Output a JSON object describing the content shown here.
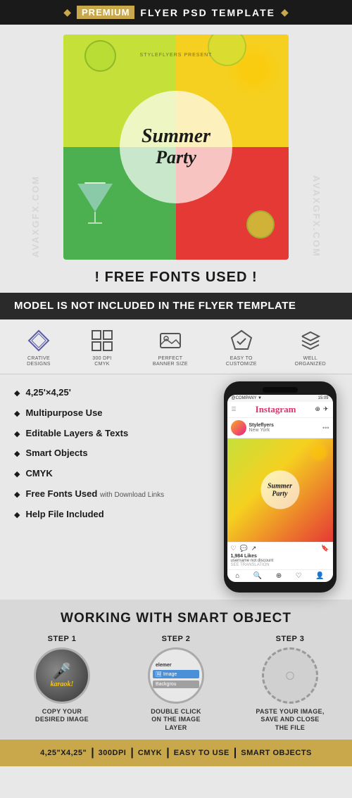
{
  "header": {
    "diamond_left": "◆",
    "diamond_right": "◆",
    "premium_label": "PREMIUM",
    "title": "FLYER PSD TEMPLATE"
  },
  "flyer": {
    "small_text": "STYLEFLYERS PRESENT",
    "title_line1": "Summer",
    "title_line2": "Party"
  },
  "free_fonts": {
    "label": "! FREE FONTS USED !"
  },
  "model_banner": {
    "text": "MODEL IS NOT INCLUDED IN THE FLYER TEMPLATE"
  },
  "icons": [
    {
      "label": "CRATIVE\nDESIGNS",
      "shape": "diamond"
    },
    {
      "label": "300 DPI\nCMYK",
      "shape": "grid"
    },
    {
      "label": "PERFECT\nBANNER SIZE",
      "shape": "image"
    },
    {
      "label": "EASY TO\nCUSTOMIZE",
      "shape": "diamond-check"
    },
    {
      "label": "WELL\nORGANIZED",
      "shape": "layers"
    }
  ],
  "features": [
    {
      "text": "4,25'×4,25'"
    },
    {
      "text": "Multipurpose Use"
    },
    {
      "text": "Editable Layers & Texts"
    },
    {
      "text": "Smart Objects"
    },
    {
      "text": "CMYK"
    },
    {
      "text": "Free Fonts Used",
      "sub": "with Download Links"
    },
    {
      "text": "Help File Included"
    }
  ],
  "phone": {
    "status_left": "@COMPANY ▼",
    "status_right": "15:09",
    "nav_logo": "Instagram",
    "username": "Styleflyers",
    "location": "New York",
    "post_title_line1": "Summer",
    "post_title_line2": "Party",
    "likes": "1,984 Likes",
    "caption_name": "username",
    "caption_text": "not discount",
    "action_text": "SEE TRANSLATION"
  },
  "smart_object": {
    "title": "WORKING WITH SMART OBJECT",
    "steps": [
      {
        "label": "STEP 1",
        "desc": "COPY YOUR\nDESIRED IMAGE",
        "type": "mic"
      },
      {
        "label": "STEP 2",
        "desc": "DOUBLE CLICK\nON THE IMAGE\nLAYER",
        "type": "layers"
      },
      {
        "label": "STEP 3",
        "desc": "PASTE YOUR IMAGE,\nSAVE AND CLOSE\nTHE FILE",
        "type": "empty"
      }
    ]
  },
  "footer": {
    "items": [
      "4,25\"x4,25\"",
      "300DPI",
      "CMYK",
      "EASY TO USE",
      "SMART OBJECTS"
    ],
    "separator": "|"
  }
}
